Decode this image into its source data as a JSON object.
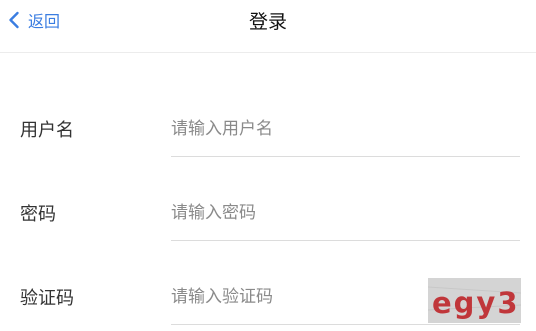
{
  "nav": {
    "back_label": "返回",
    "back_icon": "chevron-left-icon",
    "title": "登录",
    "accent": "#3a7de1"
  },
  "form": {
    "username": {
      "label": "用户名",
      "placeholder": "请输入用户名",
      "value": ""
    },
    "password": {
      "label": "密码",
      "placeholder": "请输入密码",
      "value": ""
    },
    "captcha": {
      "label": "验证码",
      "placeholder": "请输入验证码",
      "value": "",
      "image_text": "egy3"
    }
  }
}
